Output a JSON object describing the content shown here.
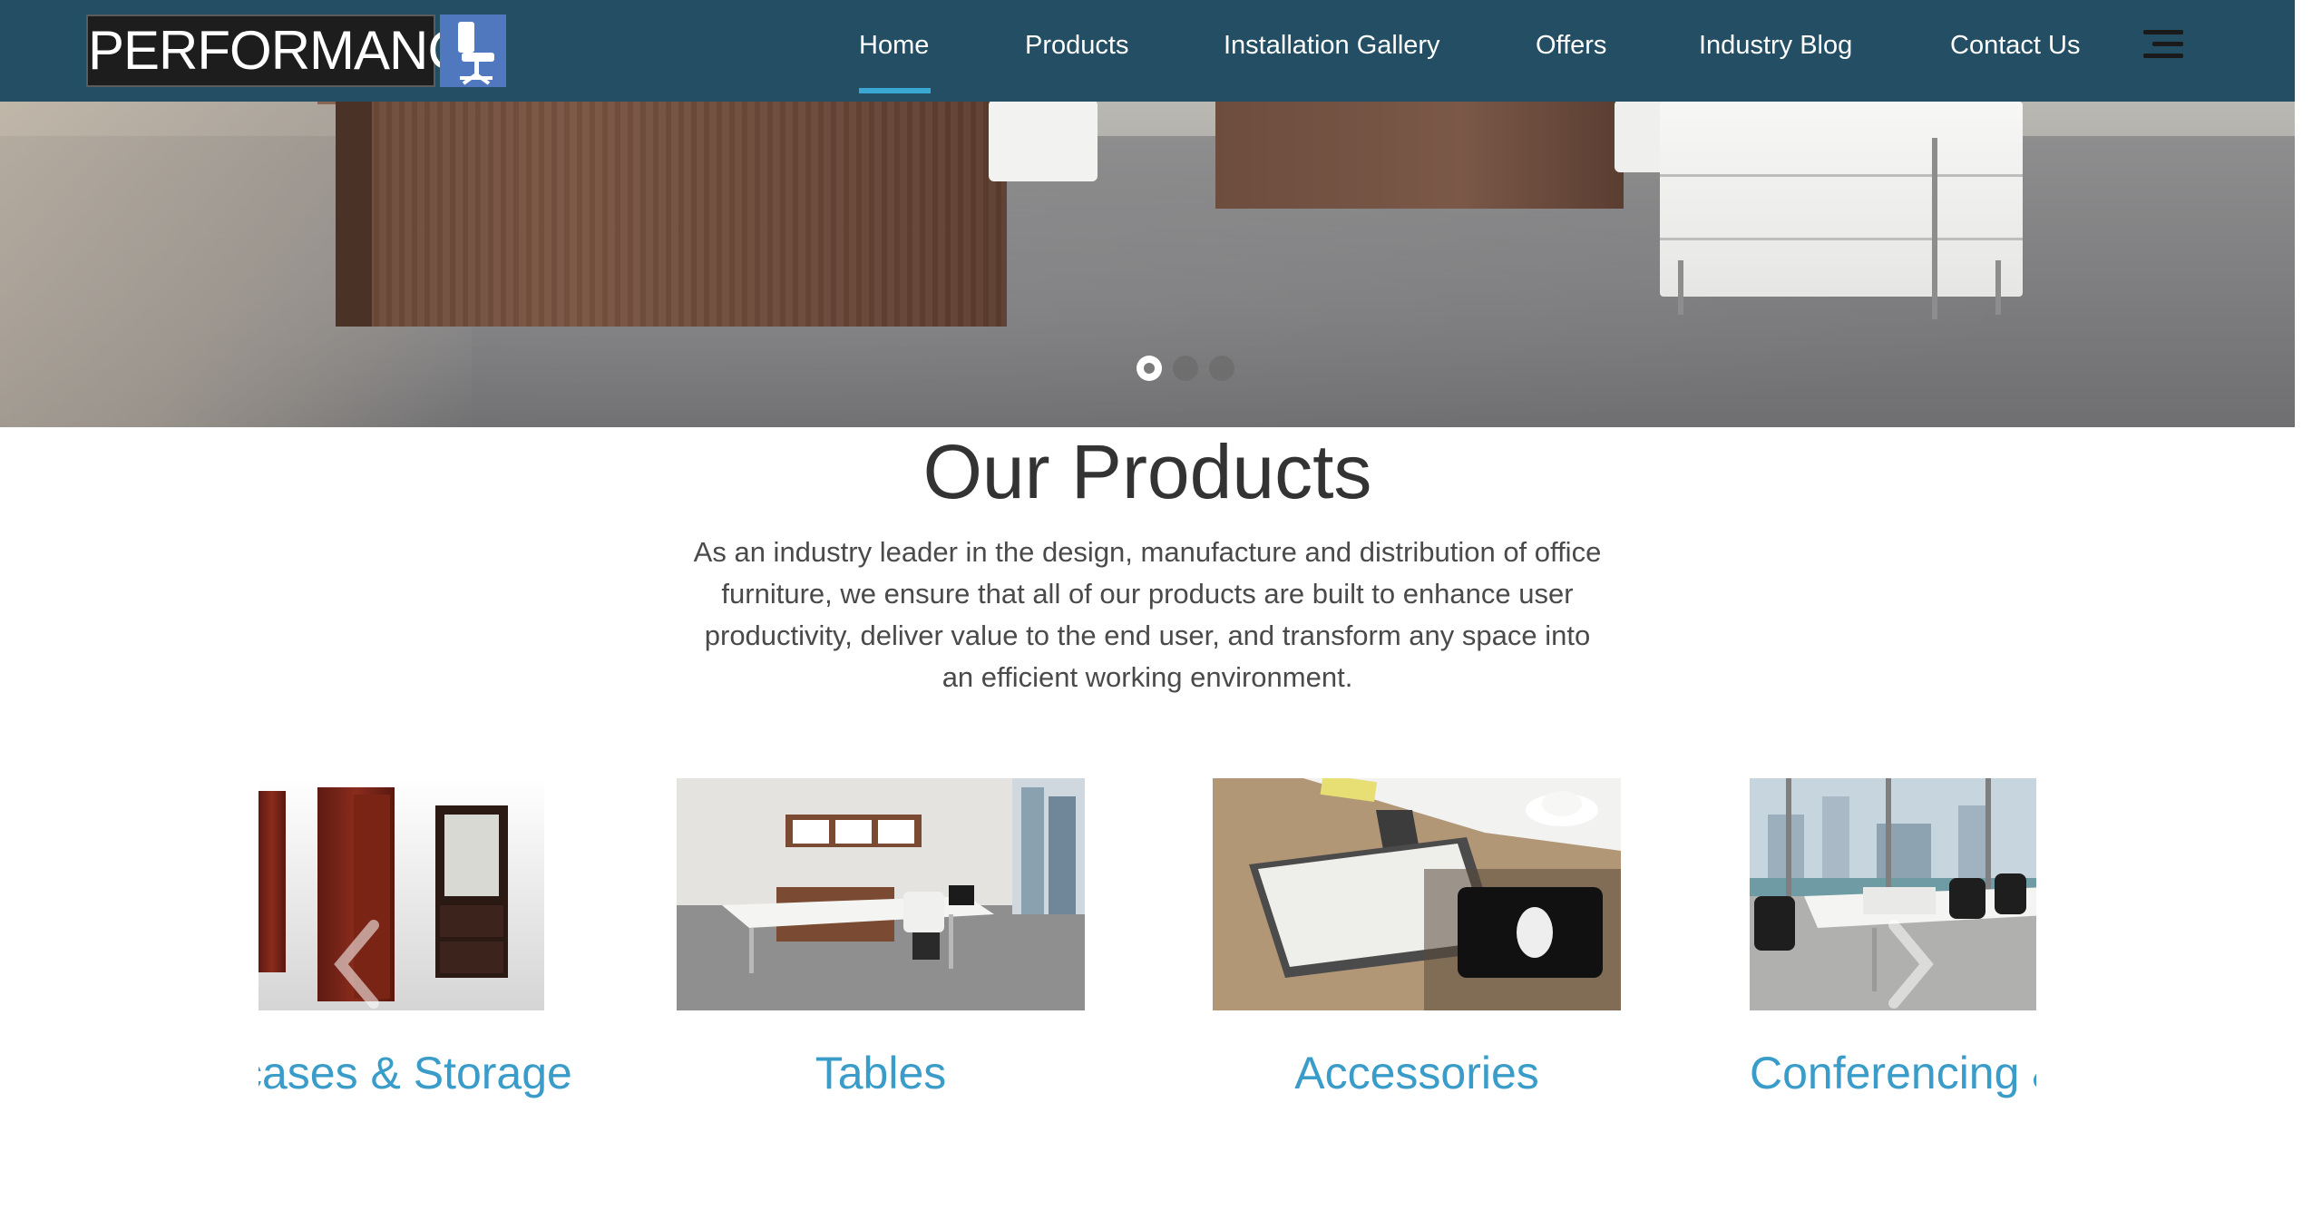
{
  "brand": {
    "logo_text": "PERFORMANCE"
  },
  "nav": {
    "items": [
      {
        "label": "Home",
        "active": true
      },
      {
        "label": "Products"
      },
      {
        "label": "Installation Gallery"
      },
      {
        "label": "Offers"
      },
      {
        "label": "Industry Blog"
      },
      {
        "label": "Contact Us"
      }
    ],
    "menu_icon": "hamburger-menu-icon"
  },
  "hero": {
    "slide_count": 3,
    "active_slide": 1
  },
  "products": {
    "title": "Our Products",
    "description": "As an industry leader in the design, manufacture and distribution of office furniture, we ensure that all of our products are built to enhance user productivity, deliver value to the end user, and transform any space into an efficient working environment.",
    "cards": [
      {
        "label": "Bookcases & Storage"
      },
      {
        "label": "Tables"
      },
      {
        "label": "Accessories"
      },
      {
        "label": "Conferencing & Seating"
      }
    ],
    "prev_icon": "chevron-left-icon",
    "next_icon": "chevron-right-icon"
  },
  "colors": {
    "header_bg": "#234e63",
    "accent": "#3aa7d5",
    "card_label": "#3a9cc9"
  }
}
